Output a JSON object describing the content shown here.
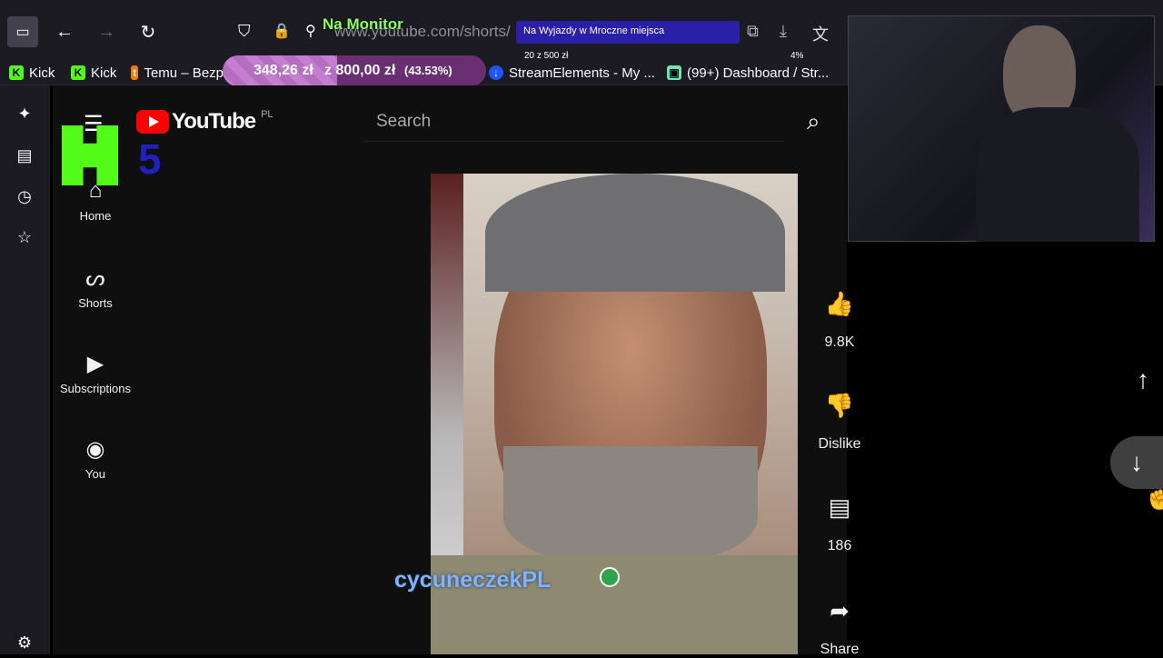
{
  "browser": {
    "url": "www.youtube.com/shorts/",
    "bookmarks": [
      {
        "label": "Kick",
        "icon_color": "#53fc18"
      },
      {
        "label": "Kick",
        "icon_color": "#53fc18"
      },
      {
        "label": "Temu – Bezp",
        "icon_color": "#fb7701"
      },
      {
        "label": "StreamElements - My ...",
        "icon_color": "#1e55ff"
      },
      {
        "label": "(99+) Dashboard / Str...",
        "icon_color": "#6ee6b0"
      }
    ]
  },
  "overlay": {
    "monitor_label": "Na Monitor",
    "goal_title": "Na Wyjazdy w Mroczne miejsca",
    "goal_sub": "20 z 500 zł",
    "goal_percent": "4%",
    "donation_amount": "348,26 zł",
    "donation_target": "z 800,00 zł",
    "donation_percent": "(43.53%)",
    "donation_fraction": 0.4353,
    "channel_tag": "cycuneczekPL"
  },
  "youtube": {
    "logo": "YouTube",
    "region": "PL",
    "search_placeholder": "Search",
    "nav": [
      {
        "label": "Home",
        "icon": "home-icon"
      },
      {
        "label": "Shorts",
        "icon": "shorts-icon"
      },
      {
        "label": "Subscriptions",
        "icon": "subscriptions-icon"
      },
      {
        "label": "You",
        "icon": "user-icon"
      }
    ],
    "actions": {
      "like_count": "9.8K",
      "dislike_label": "Dislike",
      "comment_count": "186",
      "share_label": "Share"
    }
  },
  "colors": {
    "accent": "#53fc18",
    "youtube_red": "#ff0000",
    "panel": "#1c1b22"
  }
}
